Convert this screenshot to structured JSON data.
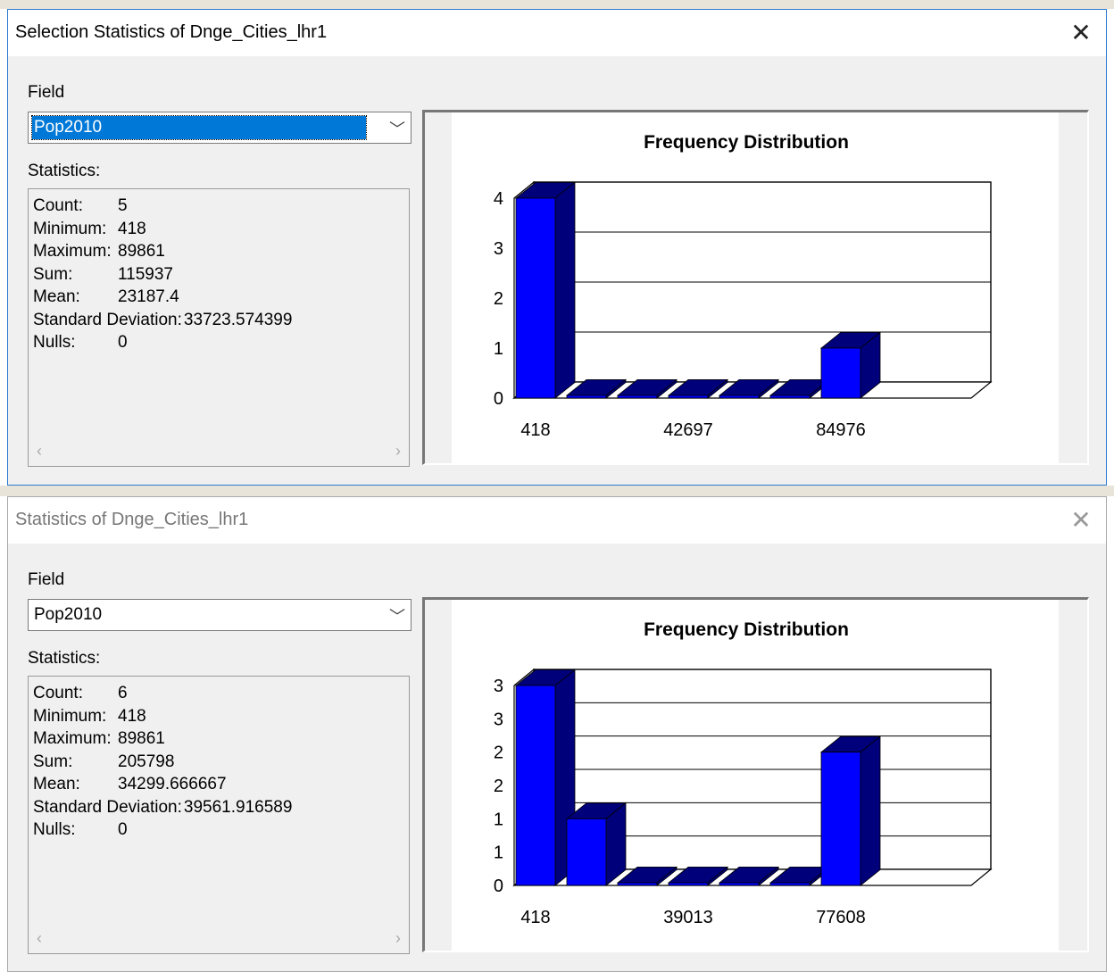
{
  "dialogs": [
    {
      "title": "Selection Statistics of Dnge_Cities_lhr1",
      "close_label": "✕",
      "field_label": "Field",
      "field_value": "Pop2010",
      "statistics_label": "Statistics:",
      "stats": [
        {
          "label": "Count:",
          "value": "5"
        },
        {
          "label": "Minimum:",
          "value": "418"
        },
        {
          "label": "Maximum:",
          "value": "89861"
        },
        {
          "label": "Sum:",
          "value": "115937"
        },
        {
          "label": "Mean:",
          "value": "23187.4"
        },
        {
          "label": "Standard Deviation:",
          "value": "33723.574399"
        },
        {
          "label": "Nulls:",
          "value": "0"
        }
      ],
      "scroll_left_icon": "‹",
      "scroll_right_icon": "›",
      "chart_data": {
        "type": "bar",
        "title": "Frequency Distribution",
        "x_tick_labels": [
          "418",
          "42697",
          "84976"
        ],
        "y_tick_labels": [
          "0",
          "1",
          "2",
          "3",
          "4"
        ],
        "values": [
          4,
          0,
          0,
          0,
          0,
          0,
          1
        ],
        "ylim": [
          0,
          4
        ],
        "bar_color": "#0000ff",
        "bar_side_color": "#00007a",
        "grid": true
      }
    },
    {
      "title": "Statistics of Dnge_Cities_lhr1",
      "close_label": "✕",
      "field_label": "Field",
      "field_value": "Pop2010",
      "statistics_label": "Statistics:",
      "stats": [
        {
          "label": "Count:",
          "value": "6"
        },
        {
          "label": "Minimum:",
          "value": "418"
        },
        {
          "label": "Maximum:",
          "value": "89861"
        },
        {
          "label": "Sum:",
          "value": "205798"
        },
        {
          "label": "Mean:",
          "value": "34299.666667"
        },
        {
          "label": "Standard Deviation:",
          "value": "39561.916589"
        },
        {
          "label": "Nulls:",
          "value": "0"
        }
      ],
      "scroll_left_icon": "‹",
      "scroll_right_icon": "›",
      "chart_data": {
        "type": "bar",
        "title": "Frequency Distribution",
        "x_tick_labels": [
          "418",
          "39013",
          "77608"
        ],
        "y_tick_labels": [
          "0",
          "1",
          "1",
          "2",
          "2",
          "3",
          "3"
        ],
        "values": [
          3,
          1,
          0,
          0,
          0,
          0,
          2
        ],
        "ylim": [
          0,
          3
        ],
        "bar_color": "#0000ff",
        "bar_side_color": "#00007a",
        "grid": true
      }
    }
  ]
}
